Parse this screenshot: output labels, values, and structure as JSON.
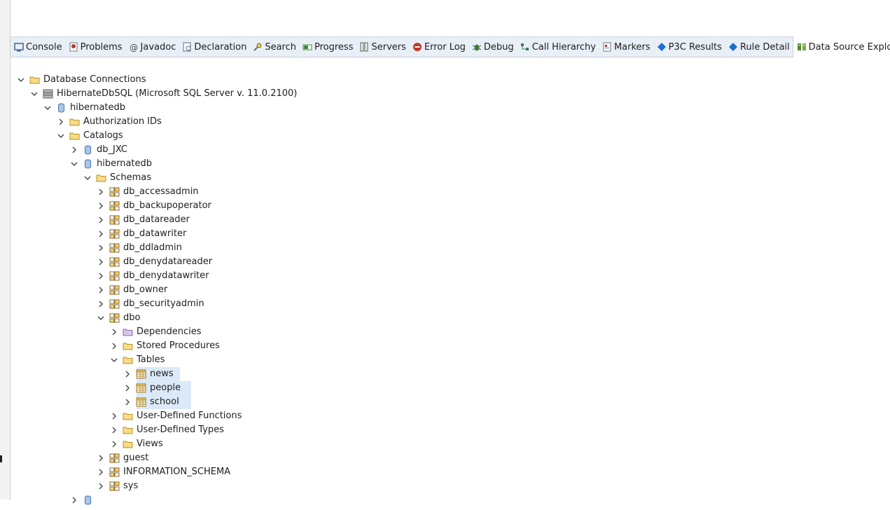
{
  "tabs": [
    {
      "label": "Console",
      "icon": "console-icon",
      "color": "#3b5a8c"
    },
    {
      "label": "Problems",
      "icon": "problems-icon",
      "color": "#b03a2e"
    },
    {
      "label": "Javadoc",
      "icon": "javadoc-icon",
      "color": "#4a4a4a"
    },
    {
      "label": "Declaration",
      "icon": "declaration-icon",
      "color": "#5a6c80"
    },
    {
      "label": "Search",
      "icon": "search-icon",
      "color": "#6a6a6a"
    },
    {
      "label": "Progress",
      "icon": "progress-icon",
      "color": "#3c8a3c"
    },
    {
      "label": "Servers",
      "icon": "servers-icon",
      "color": "#4b6b4b"
    },
    {
      "label": "Error Log",
      "icon": "error-log-icon",
      "color": "#c0392b"
    },
    {
      "label": "Debug",
      "icon": "debug-icon",
      "color": "#3e7d3e"
    },
    {
      "label": "Call Hierarchy",
      "icon": "call-hierarchy-icon",
      "color": "#3c7a5a"
    },
    {
      "label": "Markers",
      "icon": "markers-icon",
      "color": "#8a3b3b"
    },
    {
      "label": "P3C Results",
      "icon": "p3c-icon",
      "color": "#1f6fd1"
    },
    {
      "label": "Rule Detail",
      "icon": "rule-detail-icon",
      "color": "#1f6fd1"
    },
    {
      "label": "Data Source Explorer",
      "icon": "data-source-explorer-icon",
      "color": "#4f8a2f",
      "active": true
    }
  ],
  "tree": [
    {
      "label": "Database Connections",
      "depth": 0,
      "state": "open",
      "icon": "folder"
    },
    {
      "label": "HibernateDbSQL (Microsoft SQL Server v. 11.0.2100)",
      "depth": 1,
      "state": "open",
      "icon": "server"
    },
    {
      "label": "hibernatedb",
      "depth": 2,
      "state": "open",
      "icon": "database"
    },
    {
      "label": "Authorization IDs",
      "depth": 3,
      "state": "closed",
      "icon": "folder"
    },
    {
      "label": "Catalogs",
      "depth": 3,
      "state": "open",
      "icon": "folder"
    },
    {
      "label": "db_JXC",
      "depth": 4,
      "state": "closed",
      "icon": "database"
    },
    {
      "label": "hibernatedb",
      "depth": 4,
      "state": "open",
      "icon": "database"
    },
    {
      "label": "Schemas",
      "depth": 5,
      "state": "open",
      "icon": "folder"
    },
    {
      "label": "db_accessadmin",
      "depth": 6,
      "state": "closed",
      "icon": "schema"
    },
    {
      "label": "db_backupoperator",
      "depth": 6,
      "state": "closed",
      "icon": "schema"
    },
    {
      "label": "db_datareader",
      "depth": 6,
      "state": "closed",
      "icon": "schema"
    },
    {
      "label": "db_datawriter",
      "depth": 6,
      "state": "closed",
      "icon": "schema"
    },
    {
      "label": "db_ddladmin",
      "depth": 6,
      "state": "closed",
      "icon": "schema"
    },
    {
      "label": "db_denydatareader",
      "depth": 6,
      "state": "closed",
      "icon": "schema"
    },
    {
      "label": "db_denydatawriter",
      "depth": 6,
      "state": "closed",
      "icon": "schema"
    },
    {
      "label": "db_owner",
      "depth": 6,
      "state": "closed",
      "icon": "schema"
    },
    {
      "label": "db_securityadmin",
      "depth": 6,
      "state": "closed",
      "icon": "schema"
    },
    {
      "label": "dbo",
      "depth": 6,
      "state": "open",
      "icon": "schema"
    },
    {
      "label": "Dependencies",
      "depth": 7,
      "state": "closed",
      "icon": "folder-purple"
    },
    {
      "label": "Stored Procedures",
      "depth": 7,
      "state": "closed",
      "icon": "folder"
    },
    {
      "label": "Tables",
      "depth": 7,
      "state": "open",
      "icon": "folder"
    },
    {
      "label": "news",
      "depth": 8,
      "state": "closed",
      "icon": "table",
      "selected": true
    },
    {
      "label": "people",
      "depth": 8,
      "state": "closed",
      "icon": "table",
      "selected": true
    },
    {
      "label": "school",
      "depth": 8,
      "state": "closed",
      "icon": "table",
      "selected": true
    },
    {
      "label": "User-Defined Functions",
      "depth": 7,
      "state": "closed",
      "icon": "folder"
    },
    {
      "label": "User-Defined Types",
      "depth": 7,
      "state": "closed",
      "icon": "folder"
    },
    {
      "label": "Views",
      "depth": 7,
      "state": "closed",
      "icon": "folder"
    },
    {
      "label": "guest",
      "depth": 6,
      "state": "closed",
      "icon": "schema"
    },
    {
      "label": "INFORMATION_SCHEMA",
      "depth": 6,
      "state": "closed",
      "icon": "schema"
    },
    {
      "label": "sys",
      "depth": 6,
      "state": "closed",
      "icon": "schema"
    },
    {
      "label": "",
      "depth": 4,
      "state": "closed",
      "icon": "database"
    }
  ]
}
